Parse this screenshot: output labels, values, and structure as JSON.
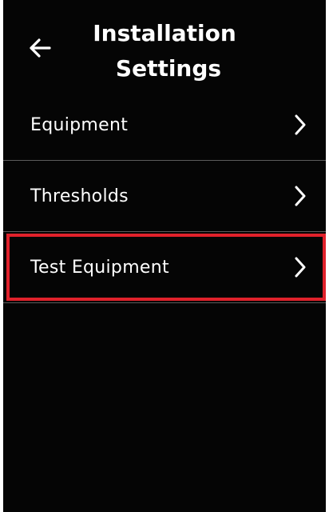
{
  "header": {
    "title_line1": "Installation",
    "title_line2": "Settings",
    "back_icon": "arrow-left-icon"
  },
  "menu": {
    "items": [
      {
        "label": "Equipment",
        "icon": "chevron-right-icon"
      },
      {
        "label": "Thresholds",
        "icon": "chevron-right-icon"
      },
      {
        "label": "Test Equipment",
        "icon": "chevron-right-icon",
        "highlighted": true
      }
    ]
  },
  "colors": {
    "background": "#050505",
    "text": "#ffffff",
    "divider": "#5b5b5b",
    "highlight_border": "#e0212b"
  }
}
